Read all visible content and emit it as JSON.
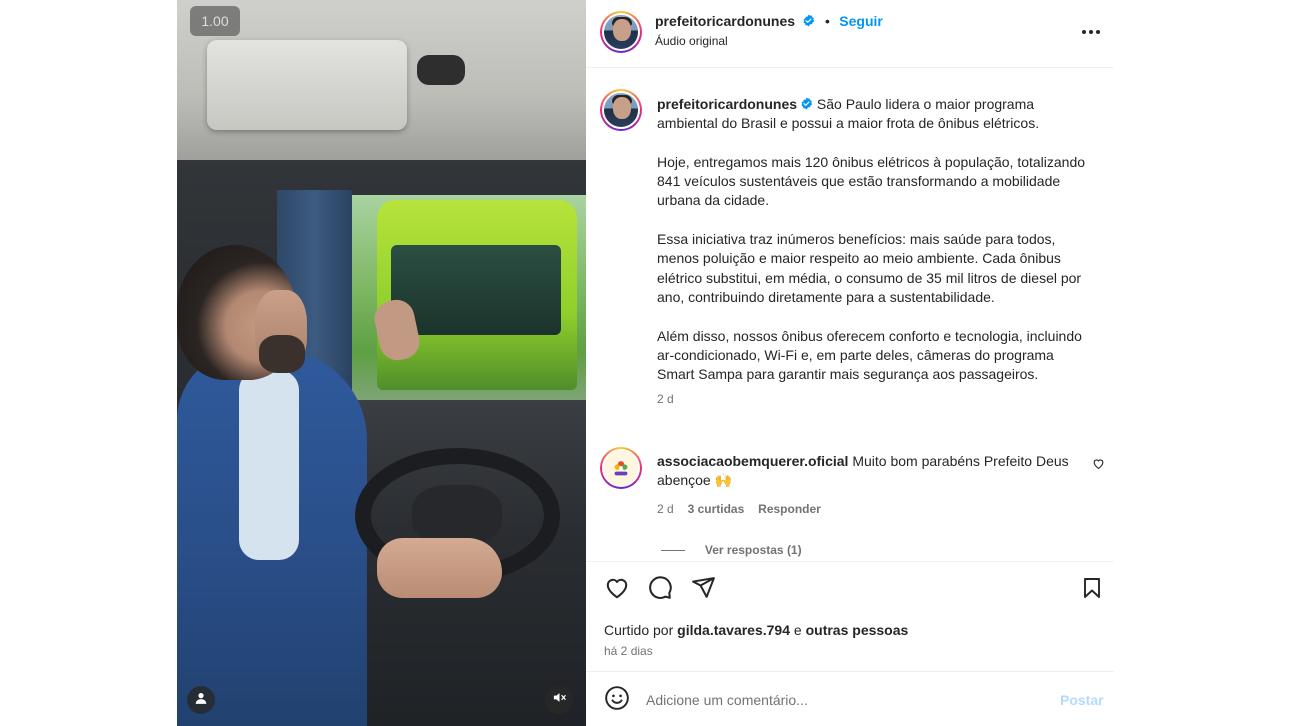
{
  "media": {
    "speed": "1.00",
    "user_icon": "user-icon",
    "mute_icon": "speaker-muted-icon"
  },
  "header": {
    "username": "prefeitoricardonunes",
    "separator": "•",
    "follow_label": "Seguir",
    "audio_label": "Áudio original",
    "more_icon": "more-horizontal-icon"
  },
  "caption": {
    "username": "prefeitoricardonunes",
    "paragraph_1": "São Paulo lidera o maior programa ambiental do Brasil e possui a maior frota de ônibus elétricos.",
    "paragraph_2": "Hoje, entregamos mais 120 ônibus elétricos à população, totalizando 841 veículos sustentáveis que estão transformando a mobilidade urbana da cidade.",
    "paragraph_3": "Essa iniciativa traz inúmeros benefícios: mais saúde para todos, menos poluição e maior respeito ao meio ambiente. Cada ônibus elétrico substitui, em média, o consumo de 35 mil litros de diesel por ano, contribuindo diretamente para a sustentabilidade.",
    "paragraph_4": "Além disso, nossos ônibus oferecem conforto e tecnologia, incluindo ar-condicionado, Wi-Fi e, em parte deles, câmeras do programa Smart Sampa para garantir mais segurança aos passageiros.",
    "time": "2 d"
  },
  "comment": {
    "username": "associacaobemquerer.oficial",
    "text": "Muito bom parabéns Prefeito Deus abençoe 🙌",
    "time": "2 d",
    "likes": "3 curtidas",
    "reply_label": "Responder",
    "view_replies": "Ver respostas (1)"
  },
  "actions": {
    "liked_by_prefix": "Curtido por",
    "liked_by_user": "gilda.tavares.794",
    "liked_by_conj": "e",
    "liked_by_others": "outras pessoas",
    "date": "há 2 dias"
  },
  "add_comment": {
    "placeholder": "Adicione um comentário...",
    "post_label": "Postar"
  },
  "colors": {
    "accent": "#0095f6",
    "verified": "#0095f6",
    "muted": "#737373",
    "post_disabled": "#b3dbff"
  }
}
